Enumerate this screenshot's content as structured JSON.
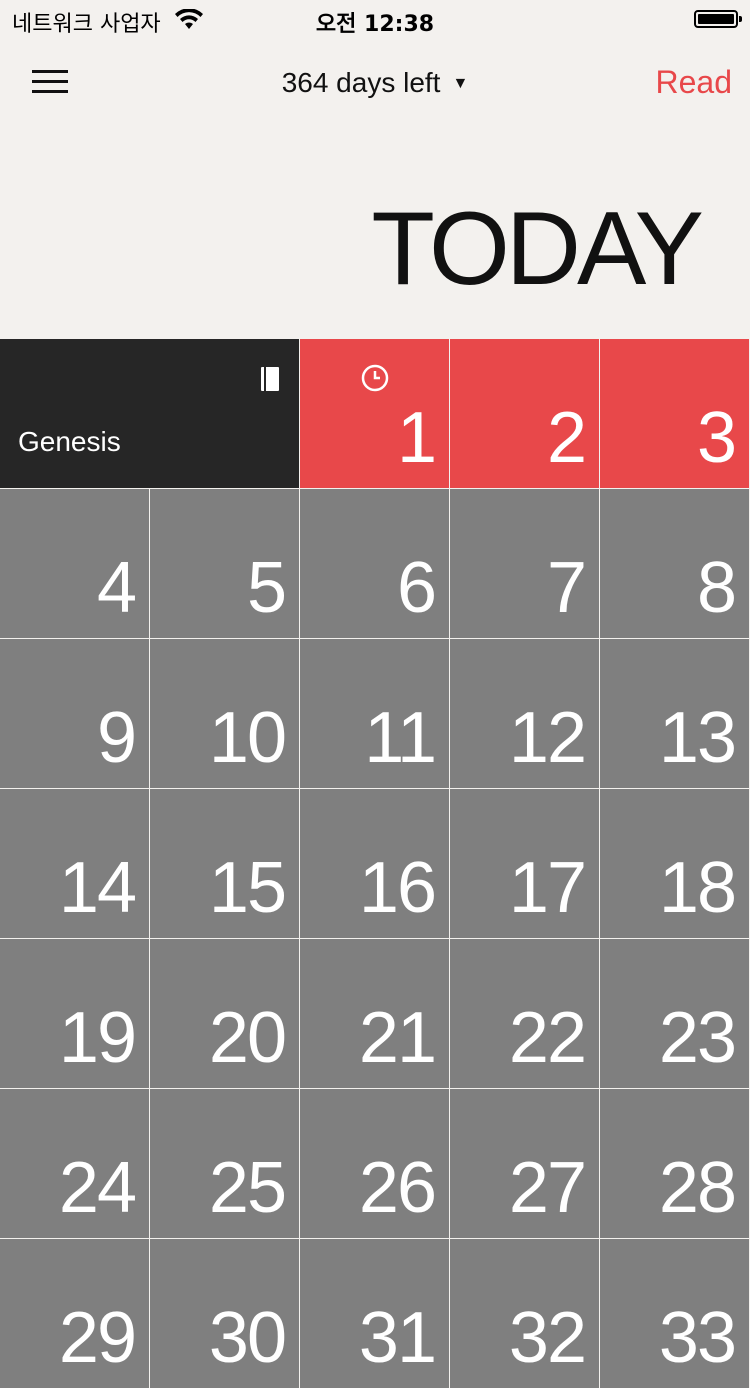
{
  "status": {
    "carrier": "네트워크 사업자",
    "time": "오전 12:38"
  },
  "nav": {
    "days_left": "364 days left",
    "read_label": "Read"
  },
  "hero": {
    "title": "TODAY"
  },
  "book": {
    "name": "Genesis"
  },
  "days": [
    "1",
    "2",
    "3",
    "4",
    "5",
    "6",
    "7",
    "8",
    "9",
    "10",
    "11",
    "12",
    "13",
    "14",
    "15",
    "16",
    "17",
    "18",
    "19",
    "20",
    "21",
    "22",
    "23",
    "24",
    "25",
    "26",
    "27",
    "28",
    "29",
    "30",
    "31",
    "32",
    "33"
  ],
  "colors": {
    "accent": "#e8484a",
    "cell": "#7f7f7f",
    "book_bg": "#262626",
    "background": "#f3f1ee"
  }
}
